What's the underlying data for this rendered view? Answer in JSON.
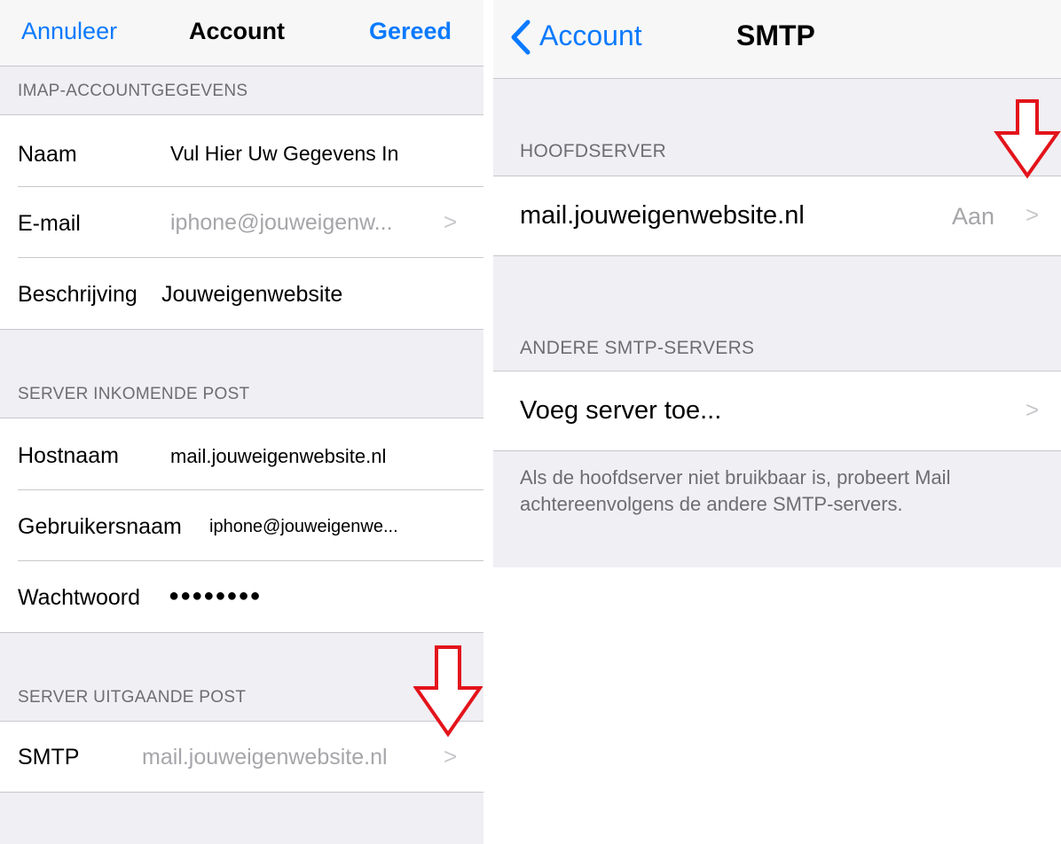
{
  "left": {
    "nav": {
      "cancel": "Annuleer",
      "title": "Account",
      "done": "Gereed"
    },
    "sections": {
      "imap": "IMAP-ACCOUNTGEGEVENS",
      "incoming": "SERVER INKOMENDE POST",
      "outgoing": "SERVER UITGAANDE POST"
    },
    "rows": {
      "name": {
        "label": "Naam",
        "value": "Vul Hier Uw Gegevens In"
      },
      "email": {
        "label": "E-mail",
        "value": "iphone@jouweigenw..."
      },
      "description": {
        "label": "Beschrijving",
        "value": "Jouweigenwebsite"
      },
      "hostname": {
        "label": "Hostnaam",
        "value": "mail.jouweigenwebsite.nl"
      },
      "username": {
        "label": "Gebruikersnaam",
        "value": "iphone@jouweigenwe..."
      },
      "password": {
        "label": "Wachtwoord",
        "value": "●●●●●●●●"
      },
      "smtp": {
        "label": "SMTP",
        "value": "mail.jouweigenwebsite.nl"
      }
    }
  },
  "right": {
    "nav": {
      "back": "Account",
      "title": "SMTP"
    },
    "sections": {
      "primary": "HOOFDSERVER",
      "other": "ANDERE SMTP-SERVERS"
    },
    "rows": {
      "primary_server": {
        "label": "mail.jouweigenwebsite.nl",
        "status": "Aan"
      },
      "add_server": {
        "label": "Voeg server toe..."
      }
    },
    "footer": "Als de hoofdserver niet bruikbaar is, probeert Mail achtereenvolgens de andere SMTP-servers."
  },
  "icons": {
    "chevron": ">",
    "back": "chevron-left-icon",
    "annotation": "red-arrow-down-icon"
  },
  "colors": {
    "accent": "#0a7aff",
    "arrow": "#e3141b",
    "secondary_text": "#8e8e93",
    "background": "#efeff4"
  }
}
